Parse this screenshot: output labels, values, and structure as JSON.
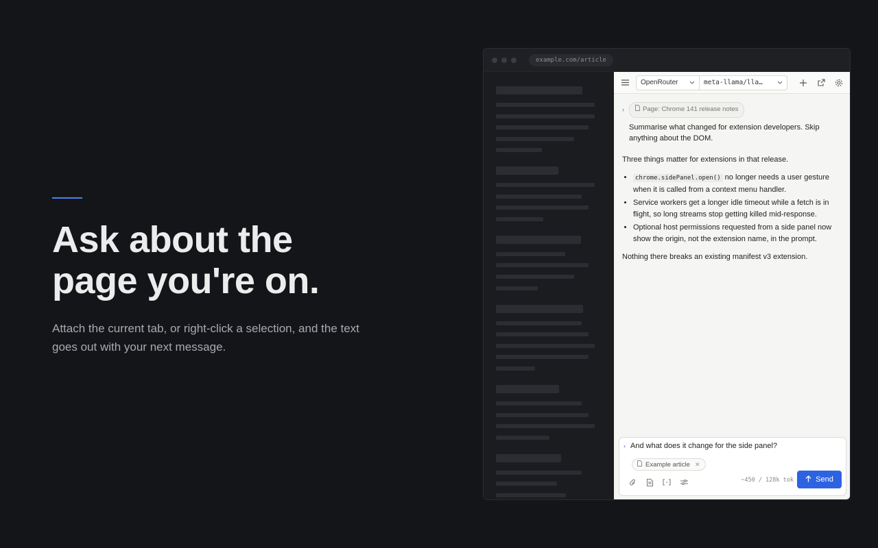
{
  "hero": {
    "title_line1": "Ask about the",
    "title_line2": "page you're on.",
    "description": "Attach the current tab, or right-click a selection, and the text goes out with your next message.",
    "accent_color": "#4a82f5"
  },
  "browser": {
    "url": "example.com/article"
  },
  "panel": {
    "toolbar": {
      "menu_icon": "menu-icon",
      "provider": "OpenRouter",
      "model": "meta-llama/lla…",
      "new_chat_icon": "plus-icon",
      "popout_icon": "external-link-icon",
      "settings_icon": "gear-icon"
    },
    "page_chip": "Page: Chrome 141 release notes",
    "user_message": "Summarise what changed for extension developers. Skip anything about the DOM.",
    "assistant": {
      "intro": "Three things matter for extensions in that release.",
      "bullet1_code": "chrome.sidePanel.open()",
      "bullet1_text": " no longer needs a user gesture when it is called from a context menu handler.",
      "bullet2": "Service workers get a longer idle timeout while a fetch is in flight, so long streams stop getting killed mid-response.",
      "bullet3": "Optional host permissions requested from a side panel now show the origin, not the extension name, in the prompt.",
      "outro": "Nothing there breaks an existing manifest v3 extension."
    },
    "composer": {
      "input_value": "And what does it change for the side panel?",
      "attachment": "Example article",
      "tokens": "~450 / 128k tok",
      "send_label": "Send",
      "accent_color": "#2d63e2"
    }
  }
}
